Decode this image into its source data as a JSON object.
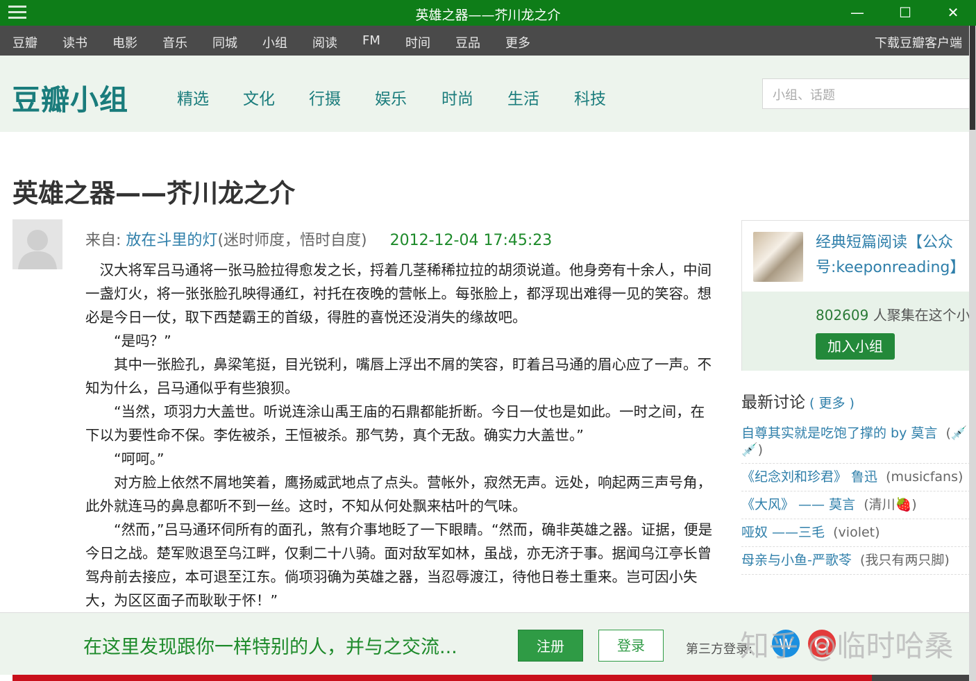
{
  "window": {
    "title": "英雄之器——芥川龙之介",
    "minimize": "—",
    "maximize": "☐",
    "close": "✕"
  },
  "topnav": {
    "items": [
      "豆瓣",
      "读书",
      "电影",
      "音乐",
      "同城",
      "小组",
      "阅读",
      "FM",
      "时间",
      "豆品",
      "更多"
    ],
    "download": "下载豆瓣客户端"
  },
  "header": {
    "logo": "豆瓣小组",
    "categories": [
      "精选",
      "文化",
      "行摄",
      "娱乐",
      "时尚",
      "生活",
      "科技"
    ],
    "search_placeholder": "小组、话题"
  },
  "post": {
    "title": "英雄之器——芥川龙之介",
    "from_label": "来自:",
    "author": "放在斗里的灯",
    "author_sig": "(迷时师度，悟时自度)",
    "datetime": "2012-12-04 17:45:23",
    "paragraphs": [
      "汉大将军吕马通将一张马脸拉得愈发之长，捋着几茎稀稀拉拉的胡须说道。他身旁有十余人，中间一盏灯火，将一张张脸孔映得通红，衬托在夜晚的营帐上。每张脸上，都浮现出难得一见的笑容。想必是今日一仗，取下西楚霸王的首级，得胜的喜悦还没消失的缘故吧。",
      "“是吗？”",
      "其中一张脸孔，鼻梁笔挺，目光锐利，嘴唇上浮出不屑的笑容，盯着吕马通的眉心应了一声。不知为什么，吕马通似乎有些狼狈。",
      "“当然，项羽力大盖世。听说连涂山禹王庙的石鼎都能折断。今日一仗也是如此。一时之间，在下以为要性命不保。李佐被杀，王恒被杀。那气势，真个无敌。确实力大盖世。”",
      "“呵呵。”",
      "对方脸上依然不屑地笑着，鹰扬威武地点了点头。营帐外，寂然无声。远处，响起两三声号角，此外就连马的鼻息都听不到一丝。这时，不知从何处飘来枯叶的气味。",
      "“然而，”吕马通环伺所有的面孔，煞有介事地眨了一下眼睛。“然而，确非英雄之器。证据，便是今日之战。楚军败退至乌江畔，仅剩二十八骑。面对敌军如林，虽战，亦无济于事。据闻乌江亭长曾驾舟前去接应，本可退至江东。倘项羽确为英雄之器，当忍辱渡江，待他日卷土重来。岂可因小失大，为区区面子而耿耿于怀！”"
    ]
  },
  "group": {
    "name": "经典短篇阅读【公众号:keeponreading】",
    "member_count": "802609",
    "member_text": "人聚集在这个小组",
    "join": "加入小组"
  },
  "latest": {
    "title": "最新讨论",
    "more": "( 更多 )",
    "items": [
      {
        "title": "自尊其实就是吃饱了撑的 by 莫言",
        "group": "(💉💉)"
      },
      {
        "title": "《纪念刘和珍君》 鲁迅",
        "group": "(musicfans)"
      },
      {
        "title": "《大风》 —— 莫言",
        "group": "(清川🍓)"
      },
      {
        "title": "哑奴 ——三毛",
        "group": "(violet)"
      },
      {
        "title": "母亲与小鱼-严歌苓",
        "group": "(我只有两只脚)"
      }
    ]
  },
  "signup": {
    "message": "在这里发现跟你一样特别的人，并与之交流...",
    "register": "注册",
    "login": "登录",
    "third_party": "第三方登录:"
  },
  "watermark": "知乎 @临时哈桑"
}
